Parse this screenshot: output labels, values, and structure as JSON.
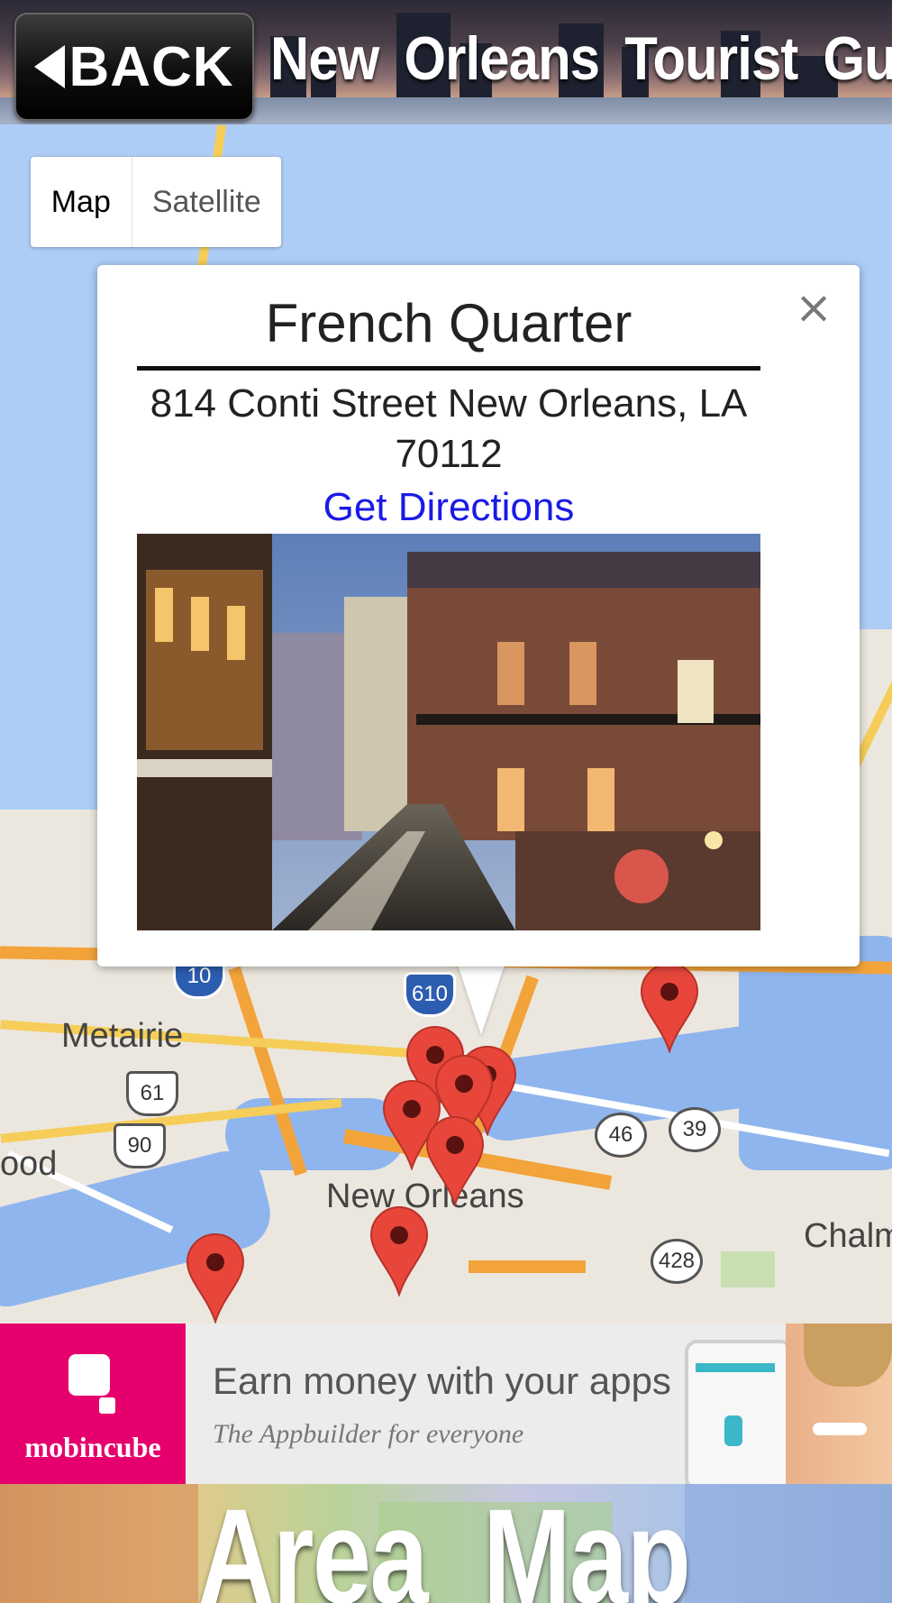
{
  "header": {
    "back_label": "BACK",
    "title": "New Orleans Tourist Guide"
  },
  "map": {
    "type_control": {
      "map_label": "Map",
      "satellite_label": "Satellite",
      "selected": "Map"
    },
    "labels": {
      "metairie": "Metairie",
      "new_orleans": "New Orleans",
      "chalmette": "Chalm",
      "left_edge": "ood"
    },
    "route_shields": {
      "i10": "10",
      "i610": "610",
      "us61": "61",
      "us90": "90",
      "la46": "46",
      "la39": "39",
      "la428": "428"
    },
    "pin_count": 9,
    "pin_color": "#e8463a"
  },
  "info_window": {
    "title": "French Quarter",
    "address": "814 Conti Street  New Orleans, LA 70112",
    "directions_label": "Get Directions",
    "close_symbol": "×"
  },
  "ad": {
    "brand": "mobincube",
    "headline": "Earn money with your apps",
    "tagline": "The Appbuilder for everyone"
  },
  "footer": {
    "label": "Area Map"
  },
  "colors": {
    "link": "#1a1ae6",
    "ad_brand": "#e5006e",
    "water": "#aecdf6"
  }
}
